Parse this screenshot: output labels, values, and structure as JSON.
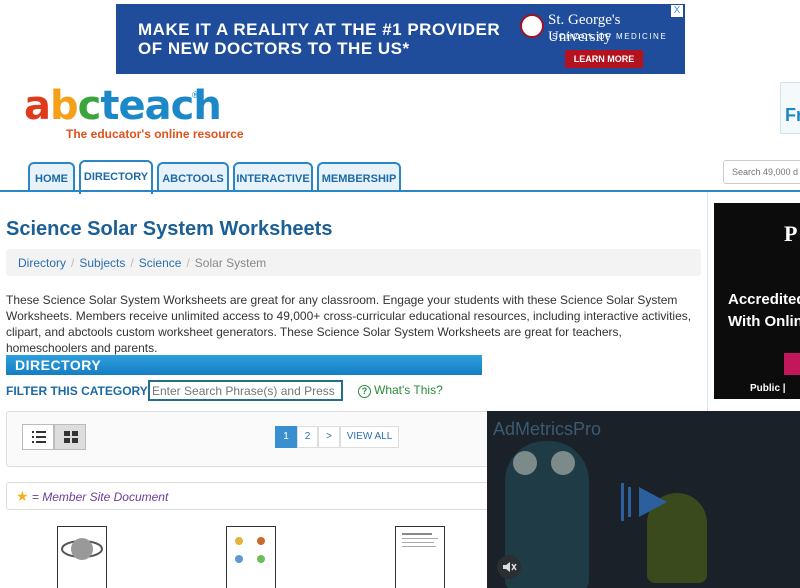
{
  "top_ad": {
    "line1": "MAKE IT A REALITY AT THE #1 PROVIDER",
    "line2": "OF NEW DOCTORS TO THE US*",
    "university": "St. George's University",
    "school": "SCHOOL OF MEDICINE",
    "cta": "LEARN MORE",
    "close": "X"
  },
  "logo": {
    "letters": [
      "a",
      "b",
      "c",
      "teach"
    ],
    "tagline": "The educator's online resource",
    "reg": "®"
  },
  "right_edge_text": "Fr",
  "nav": {
    "tabs": [
      "HOME",
      "DIRECTORY",
      "ABCTOOLS",
      "INTERACTIVE",
      "MEMBERSHIP"
    ],
    "active": "DIRECTORY",
    "search_placeholder": "Search 49,000 d"
  },
  "page": {
    "title": "Science Solar System Worksheets",
    "breadcrumb": [
      "Directory",
      "Subjects",
      "Science",
      "Solar System"
    ],
    "intro": "These Science Solar System Worksheets are great for any classroom. Engage your students with these Science Solar System Worksheets. Members receive unlimited access to 49,000+ cross-curricular educational resources, including interactive activities, clipart, and abctools custom worksheet generators. These Science Solar System Worksheets are great for teachers, homeschoolers and parents."
  },
  "directory": {
    "header": "DIRECTORY",
    "filter_label": "FILTER THIS CATEGORY:",
    "filter_placeholder": "Enter Search Phrase(s) and Press Ente",
    "whats_this": "What's This?",
    "pagination": [
      "1",
      "2",
      ">",
      "VIEW ALL"
    ],
    "member_note": "= Member Site Document"
  },
  "side_ad": {
    "logo_letter": "P",
    "line1": "Accredited",
    "line2": "With Onlin",
    "footer": "Public |"
  },
  "video": {
    "brand": "AdMetricsPro"
  },
  "colors": {
    "accent": "#2a86c6",
    "title": "#1b5f95",
    "directory_bar": "#1a8ad0"
  }
}
